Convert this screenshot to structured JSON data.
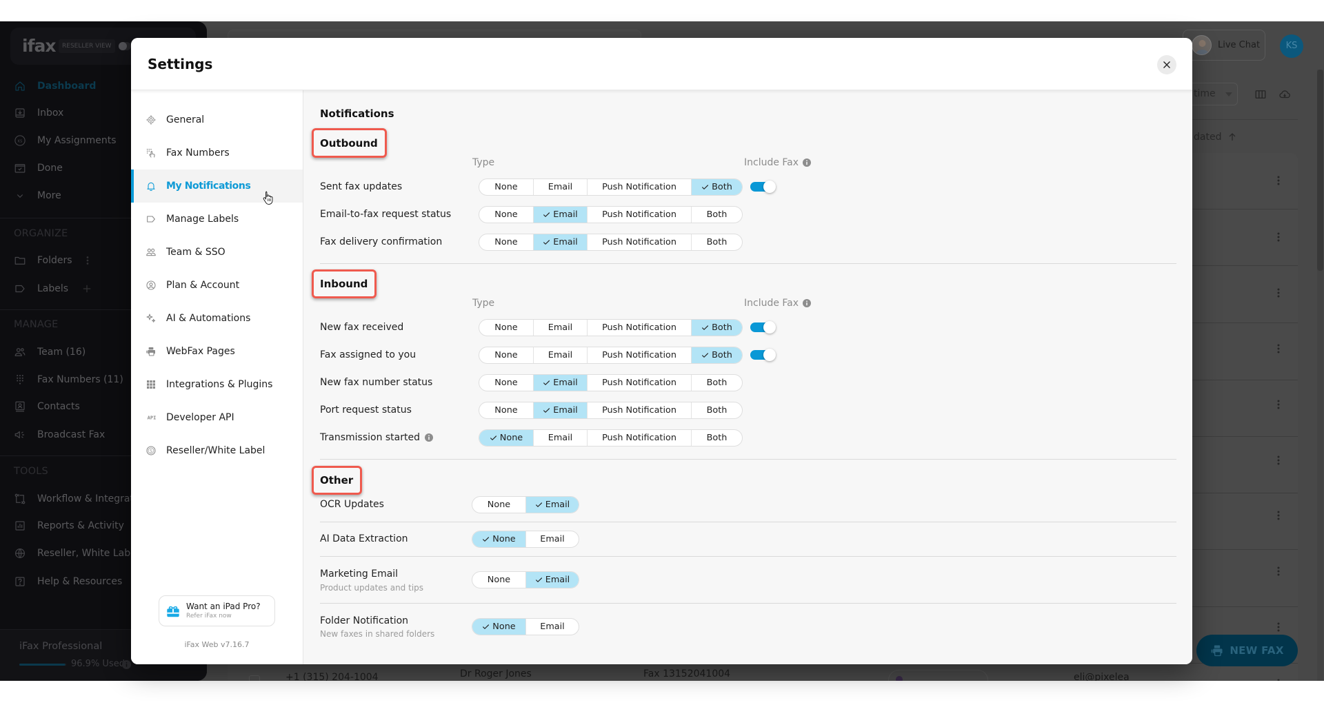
{
  "app_sidebar": {
    "logo_text": "ifax",
    "reseller_view_label": "RESELLER VIEW",
    "reseller_view_enabled": false,
    "primary_nav": [
      {
        "label": "Dashboard",
        "icon": "home-icon",
        "active": true
      },
      {
        "label": "Inbox",
        "icon": "inbox-icon",
        "active": false
      },
      {
        "label": "My Assignments",
        "icon": "assignments-ks-icon",
        "active": false
      },
      {
        "label": "Done",
        "icon": "done-icon",
        "active": false
      },
      {
        "label": "More",
        "icon": "chevron-down-icon",
        "active": false
      }
    ],
    "organize": {
      "title": "ORGANIZE",
      "items": [
        {
          "label": "Folders",
          "icon": "folder-icon",
          "action_icon": "kebab-icon"
        },
        {
          "label": "Labels",
          "icon": "label-icon",
          "action_icon": "plus-icon"
        }
      ]
    },
    "manage": {
      "title": "MANAGE",
      "items": [
        {
          "label": "Team (16)",
          "icon": "team-icon"
        },
        {
          "label": "Fax Numbers (11)",
          "icon": "keypad-icon"
        },
        {
          "label": "Contacts",
          "icon": "contacts-icon"
        },
        {
          "label": "Broadcast Fax",
          "icon": "megaphone-icon"
        }
      ]
    },
    "tools": {
      "title": "TOOLS",
      "items": [
        {
          "label": "Workflow & Integrations",
          "icon": "workflow-icon"
        },
        {
          "label": "Reports & Activity",
          "icon": "reports-icon"
        },
        {
          "label": "Reseller, White Label",
          "icon": "globe-icon"
        },
        {
          "label": "Help & Resources",
          "icon": "help-icon"
        }
      ]
    },
    "plan": {
      "name": "iFax Professional",
      "usage_percent": 96.9,
      "usage_label": "96.9% Used"
    }
  },
  "top_bar": {
    "live_chat_label": "Live Chat",
    "avatar_initials": "KS"
  },
  "list_toolbar": {
    "time_filter_value": "time",
    "sort_column_label": "dated",
    "sort_direction": "ascending"
  },
  "list": {
    "rows_visible": 10,
    "last_row": {
      "phone": "+1 (315) 204-1004",
      "contact": "Dr Roger Jones",
      "fax_name": "Fax 13152041004",
      "email": "eli@pixelea"
    }
  },
  "new_fax_label": "NEW FAX",
  "settings_modal": {
    "title": "Settings",
    "nav": [
      {
        "label": "General",
        "icon": "gear-icon",
        "active": false
      },
      {
        "label": "Fax Numbers",
        "icon": "fax-keypad-icon",
        "active": false
      },
      {
        "label": "My Notifications",
        "icon": "bell-icon",
        "active": true
      },
      {
        "label": "Manage Labels",
        "icon": "label-icon",
        "active": false
      },
      {
        "label": "Team & SSO",
        "icon": "team-icon",
        "active": false
      },
      {
        "label": "Plan & Account",
        "icon": "user-circle-icon",
        "active": false
      },
      {
        "label": "AI & Automations",
        "icon": "sparkle-icon",
        "active": false
      },
      {
        "label": "WebFax Pages",
        "icon": "printer-icon",
        "active": false
      },
      {
        "label": "Integrations & Plugins",
        "icon": "grid-icon",
        "active": false
      },
      {
        "label": "Developer API",
        "icon": "api-icon",
        "active": false
      },
      {
        "label": "Reseller/White Label",
        "icon": "dollar-circle-icon",
        "active": false
      }
    ],
    "promo": {
      "title": "Want an iPad Pro?",
      "subtitle": "Refer iFax now",
      "icon": "gift-icon"
    },
    "version": "iFax Web v7.16.7",
    "content": {
      "heading": "Notifications",
      "type_header": "Type",
      "include_fax_header": "Include Fax",
      "sections": [
        {
          "title": "Outbound",
          "highlighted": true,
          "options": [
            "None",
            "Email",
            "Push Notification",
            "Both"
          ],
          "rows": [
            {
              "label": "Sent fax updates",
              "selected": "Both",
              "include_fax": true
            },
            {
              "label": "Email-to-fax request status",
              "selected": "Email"
            },
            {
              "label": "Fax delivery confirmation",
              "selected": "Email"
            }
          ]
        },
        {
          "title": "Inbound",
          "highlighted": true,
          "options": [
            "None",
            "Email",
            "Push Notification",
            "Both"
          ],
          "rows": [
            {
              "label": "New fax received",
              "selected": "Both",
              "include_fax": true
            },
            {
              "label": "Fax assigned to you",
              "selected": "Both",
              "include_fax": true
            },
            {
              "label": "New fax number status",
              "selected": "Email"
            },
            {
              "label": "Port request status",
              "selected": "Email"
            },
            {
              "label": "Transmission started",
              "selected": "None",
              "info": true
            }
          ]
        }
      ],
      "other": {
        "title": "Other",
        "highlighted": true,
        "options": [
          "None",
          "Email"
        ],
        "rows": [
          {
            "label": "OCR Updates",
            "selected": "Email"
          },
          {
            "label": "AI Data Extraction",
            "selected": "None"
          },
          {
            "label": "Marketing Email",
            "subtitle": "Product updates and tips",
            "selected": "Email"
          },
          {
            "label": "Folder Notification",
            "subtitle": "New faxes in shared folders",
            "selected": "None"
          }
        ]
      }
    }
  },
  "colors": {
    "accent": "#0a9bd8",
    "selected_option": "#b3e4f6",
    "toggle_on": "#0a98d6",
    "annotation_highlight": "#ef5a4e"
  }
}
